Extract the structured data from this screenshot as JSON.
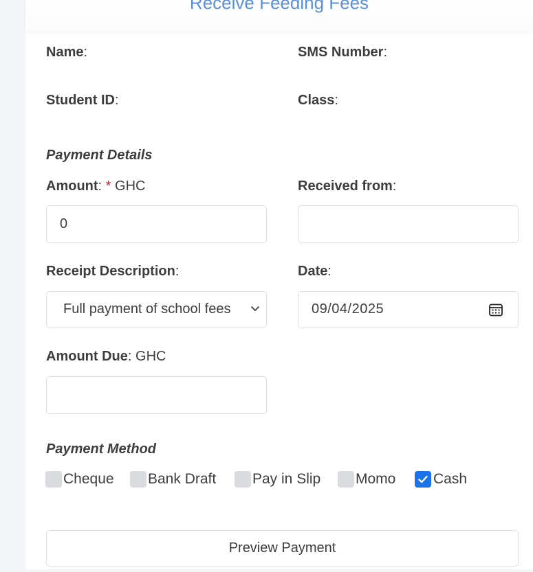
{
  "title": "Receive Feeding Fees",
  "info": {
    "name_label": "Name",
    "sms_label": "SMS Number",
    "student_id_label": "Student ID",
    "class_label": "Class",
    "colon": ":"
  },
  "payment_details": {
    "heading": "Payment Details",
    "amount_label": "Amount",
    "required_mark": "*",
    "amount_currency": "GHC",
    "amount_value": "0",
    "received_from_label": "Received from",
    "received_from_value": "",
    "receipt_description_label": "Receipt Description",
    "receipt_description_selected": "Full payment of school fees",
    "date_label": "Date",
    "date_value": "09/04/2025",
    "amount_due_label": "Amount Due",
    "amount_due_currency": "GHC",
    "amount_due_value": ""
  },
  "payment_method": {
    "heading": "Payment Method",
    "options": [
      {
        "label": "Cheque",
        "checked": false
      },
      {
        "label": "Bank Draft",
        "checked": false
      },
      {
        "label": "Pay in Slip",
        "checked": false
      },
      {
        "label": "Momo",
        "checked": false
      },
      {
        "label": "Cash",
        "checked": true
      }
    ]
  },
  "actions": {
    "preview_label": "Preview Payment"
  },
  "icons": {
    "select_arrow": "chevron-down-icon",
    "date_picker": "calendar-icon",
    "checkbox_check": "checkmark-icon"
  },
  "colors": {
    "title": "#5b8fd9",
    "required": "#d6202a",
    "checkbox_checked": "#1a73e8",
    "checkbox_unchecked": "#d9dbde"
  }
}
